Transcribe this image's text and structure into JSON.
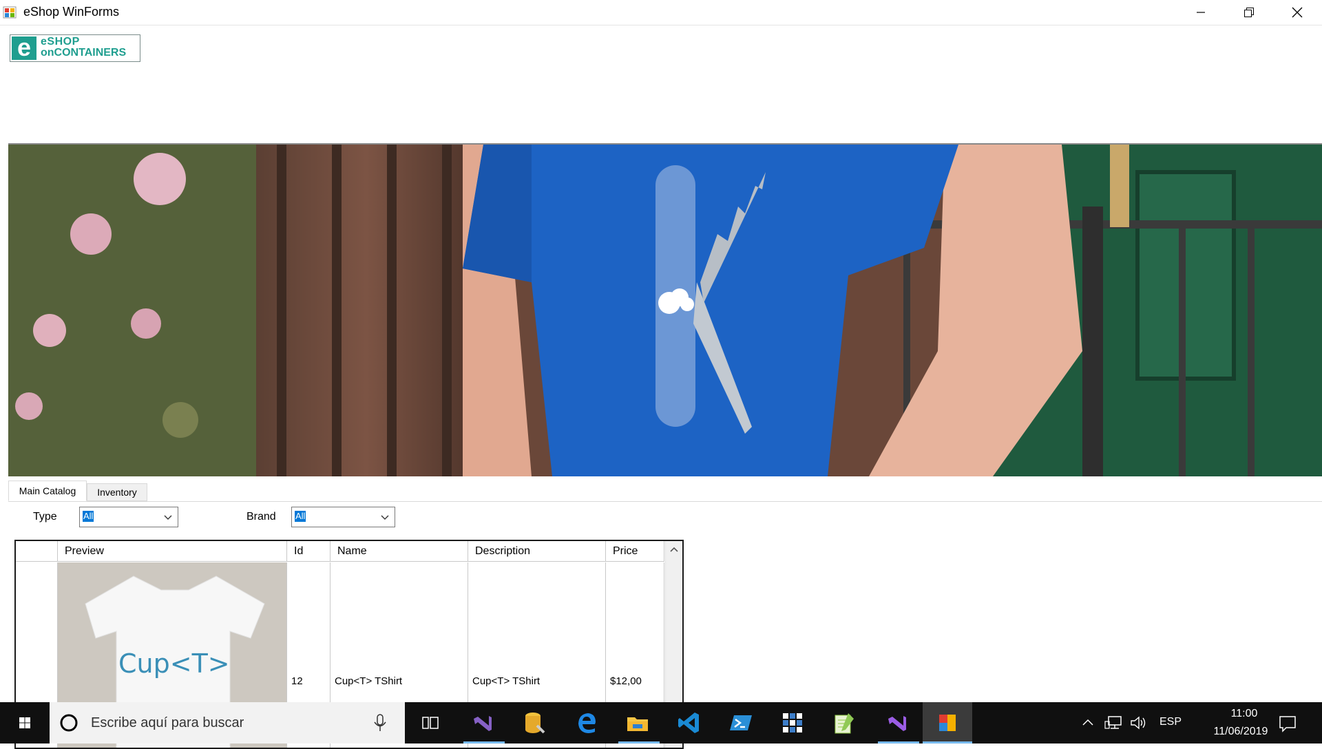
{
  "window": {
    "title": "eShop WinForms"
  },
  "logo": {
    "letter": "e",
    "line1": "eSHOP",
    "line2": "onCONTAINERS"
  },
  "tabs": [
    {
      "label": "Main Catalog"
    },
    {
      "label": "Inventory"
    }
  ],
  "filters": {
    "type": {
      "label": "Type",
      "value": "All"
    },
    "brand": {
      "label": "Brand",
      "value": "All"
    }
  },
  "grid": {
    "columns": [
      "Preview",
      "Id",
      "Name",
      "Description",
      "Price"
    ],
    "rows": [
      {
        "preview_text": "Cup<T>",
        "id": "12",
        "name": "Cup<T> TShirt",
        "description": "Cup<T> TShirt",
        "price": "$12,00"
      }
    ]
  },
  "taskbar": {
    "search_placeholder": "Escribe aquí para buscar",
    "language": "ESP",
    "time": "11:00",
    "date": "11/06/2019"
  },
  "colors": {
    "accent": "#0078d7",
    "brand": "#1f9e8f",
    "taskbar": "#101010"
  }
}
